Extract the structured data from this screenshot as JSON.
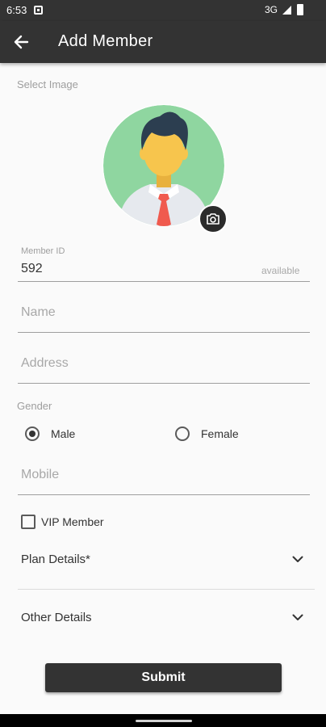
{
  "status_bar": {
    "time": "6:53",
    "network": "3G"
  },
  "app_bar": {
    "title": "Add Member"
  },
  "form": {
    "select_image_label": "Select Image",
    "member_id": {
      "label": "Member ID",
      "value": "592",
      "status": "available"
    },
    "name": {
      "placeholder": "Name"
    },
    "address": {
      "placeholder": "Address"
    },
    "gender": {
      "label": "Gender",
      "options": [
        "Male",
        "Female"
      ],
      "selected": "Male"
    },
    "mobile": {
      "placeholder": "Mobile"
    },
    "vip_member": {
      "label": "VIP Member",
      "checked": false
    },
    "sections": [
      {
        "title": "Plan Details*"
      },
      {
        "title": "Other Details"
      }
    ],
    "submit_label": "Submit"
  },
  "colors": {
    "app_bar": "#333333",
    "avatar_bg": "#8fd6a0",
    "shirt": "#e6e9ee",
    "tie": "#f05a4e",
    "hair": "#2c3e50",
    "skin": "#f7c54d"
  },
  "icons": {
    "back": "arrow-left-icon",
    "camera": "camera-icon",
    "expand": "chevron-down-icon"
  }
}
